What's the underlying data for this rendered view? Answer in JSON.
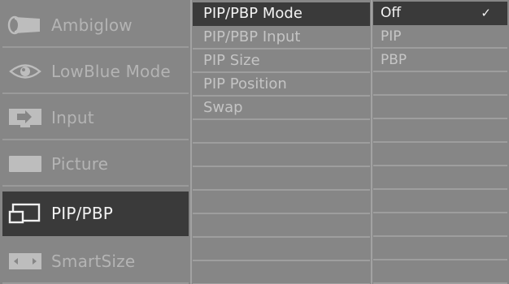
{
  "main_menu": {
    "items": [
      {
        "label": "Ambiglow",
        "icon": "ambiglow-icon"
      },
      {
        "label": "LowBlue Mode",
        "icon": "eye-icon"
      },
      {
        "label": "Input",
        "icon": "input-icon"
      },
      {
        "label": "Picture",
        "icon": "picture-icon"
      },
      {
        "label": "PIP/PBP",
        "icon": "pip-pbp-icon"
      },
      {
        "label": "SmartSize",
        "icon": "smartsize-icon"
      }
    ],
    "selected": "PIP/PBP"
  },
  "submenu": {
    "items": [
      {
        "label": "PIP/PBP Mode"
      },
      {
        "label": "PIP/PBP Input"
      },
      {
        "label": "PIP Size"
      },
      {
        "label": "PIP Position"
      },
      {
        "label": "Swap"
      }
    ],
    "selected": "PIP/PBP Mode"
  },
  "options": {
    "items": [
      {
        "label": "Off"
      },
      {
        "label": "PIP"
      },
      {
        "label": "PBP"
      }
    ],
    "selected": "Off",
    "checkmark": "✓"
  },
  "colors": {
    "background": "#868686",
    "highlight": "#3a3a3a",
    "text_dim": "#b4b4b4",
    "text_active": "#f2f2f2"
  }
}
